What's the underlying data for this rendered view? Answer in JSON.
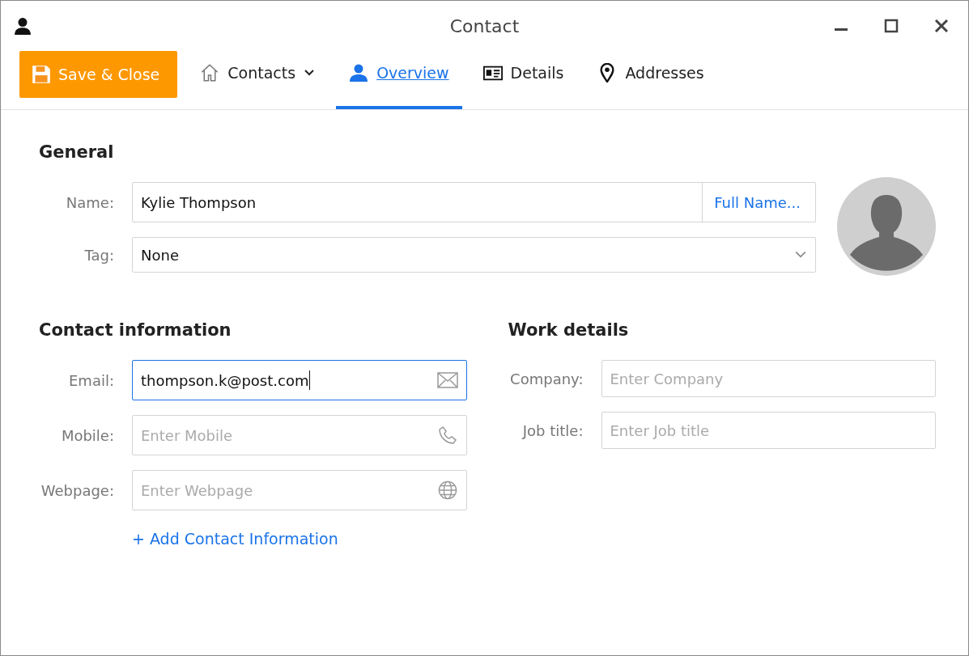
{
  "window": {
    "title": "Contact"
  },
  "toolbar": {
    "save_button": "Save & Close",
    "tabs": [
      {
        "label": "Contacts",
        "kind": "home",
        "selected": false
      },
      {
        "label": "Overview",
        "kind": "person",
        "selected": true
      },
      {
        "label": "Details",
        "kind": "card",
        "selected": false
      },
      {
        "label": "Addresses",
        "kind": "pin",
        "selected": false
      }
    ]
  },
  "general": {
    "title": "General",
    "name": {
      "label": "Name:",
      "value": "Kylie Thompson",
      "button": "Full Name..."
    },
    "tag": {
      "label": "Tag:",
      "value": "None"
    }
  },
  "contact_information": {
    "title": "Contact information",
    "fields": [
      {
        "label": "Email:",
        "value": "thompson.k@post.com",
        "kind": "email",
        "focused": true
      },
      {
        "label": "Mobile:",
        "placeholder": "Enter Mobile",
        "kind": "phone",
        "focused": false
      },
      {
        "label": "Webpage:",
        "placeholder": "Enter Webpage",
        "kind": "web",
        "focused": false
      }
    ],
    "add_link": "+ Add Contact Information"
  },
  "work_details": {
    "title": "Work details",
    "fields": [
      {
        "label": "Company:",
        "placeholder": "Enter Company"
      },
      {
        "label": "Job title:",
        "placeholder": "Enter Job title"
      }
    ]
  }
}
